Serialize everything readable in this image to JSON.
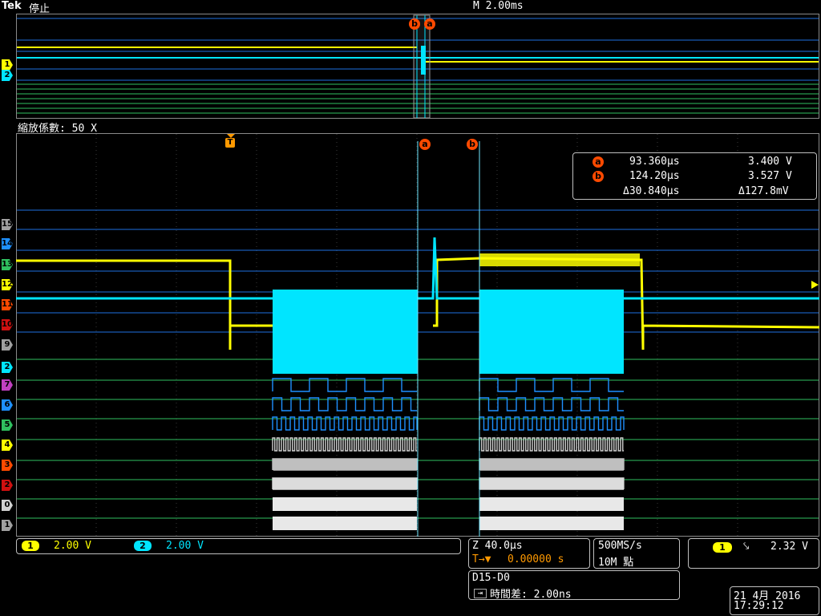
{
  "header": {
    "brand": "Tek",
    "run_state": "停止",
    "timebase": "M 2.00ms"
  },
  "overview": {
    "cursor_b_label": "b",
    "cursor_a_label": "a",
    "channel_markers": [
      "1",
      "2"
    ]
  },
  "zoom": {
    "factor_label": "縮放係數: 50 X",
    "trigger_marker": "T",
    "cursor_a_label": "a",
    "cursor_b_label": "b"
  },
  "readout": {
    "cursor_a": {
      "badge": "a",
      "time": "93.360µs",
      "voltage": "3.400 V"
    },
    "cursor_b": {
      "badge": "b",
      "time": "124.20µs",
      "voltage": "3.527 V"
    },
    "delta": {
      "time": "Δ30.840µs",
      "voltage": "Δ127.8mV"
    }
  },
  "channel_labels": [
    {
      "id": "15",
      "label": "15"
    },
    {
      "id": "14",
      "label": "14"
    },
    {
      "id": "13",
      "label": "13"
    },
    {
      "id": "12",
      "label": "12"
    },
    {
      "id": "11",
      "label": "11"
    },
    {
      "id": "10",
      "label": "10"
    },
    {
      "id": "9",
      "label": "9"
    },
    {
      "id": "ch2",
      "label": "2"
    },
    {
      "id": "7",
      "label": "7"
    },
    {
      "id": "6",
      "label": "6"
    },
    {
      "id": "5",
      "label": "5"
    },
    {
      "id": "4",
      "label": "4"
    },
    {
      "id": "3",
      "label": "3"
    },
    {
      "id": "2",
      "label": "2"
    },
    {
      "id": "0",
      "label": "0"
    },
    {
      "id": "1",
      "label": "1"
    }
  ],
  "bottom": {
    "ch1": {
      "chip": "1",
      "scale": "2.00 V"
    },
    "ch2": {
      "chip": "2",
      "scale": "2.00 V"
    },
    "zoom_time": "Z 40.0µs",
    "trigger_pos_prefix": "T→▼",
    "trigger_pos": "0.00000 s",
    "sample_rate": "500MS/s",
    "record_length": "10M 點",
    "trigger_chip": "1",
    "trigger_slope": "⤥",
    "trigger_level": "2.32 V",
    "digital_group": "D15-D0",
    "deskew_label": "時間差: 2.00ns",
    "date": "21 4月  2016",
    "time": "17:29:12"
  },
  "colors": {
    "ch1": "#ffff00",
    "ch2": "#00e5ff",
    "digital_line": "#1e90ff",
    "green_line": "#2fbf5f",
    "cursor": "#ff4a00"
  }
}
